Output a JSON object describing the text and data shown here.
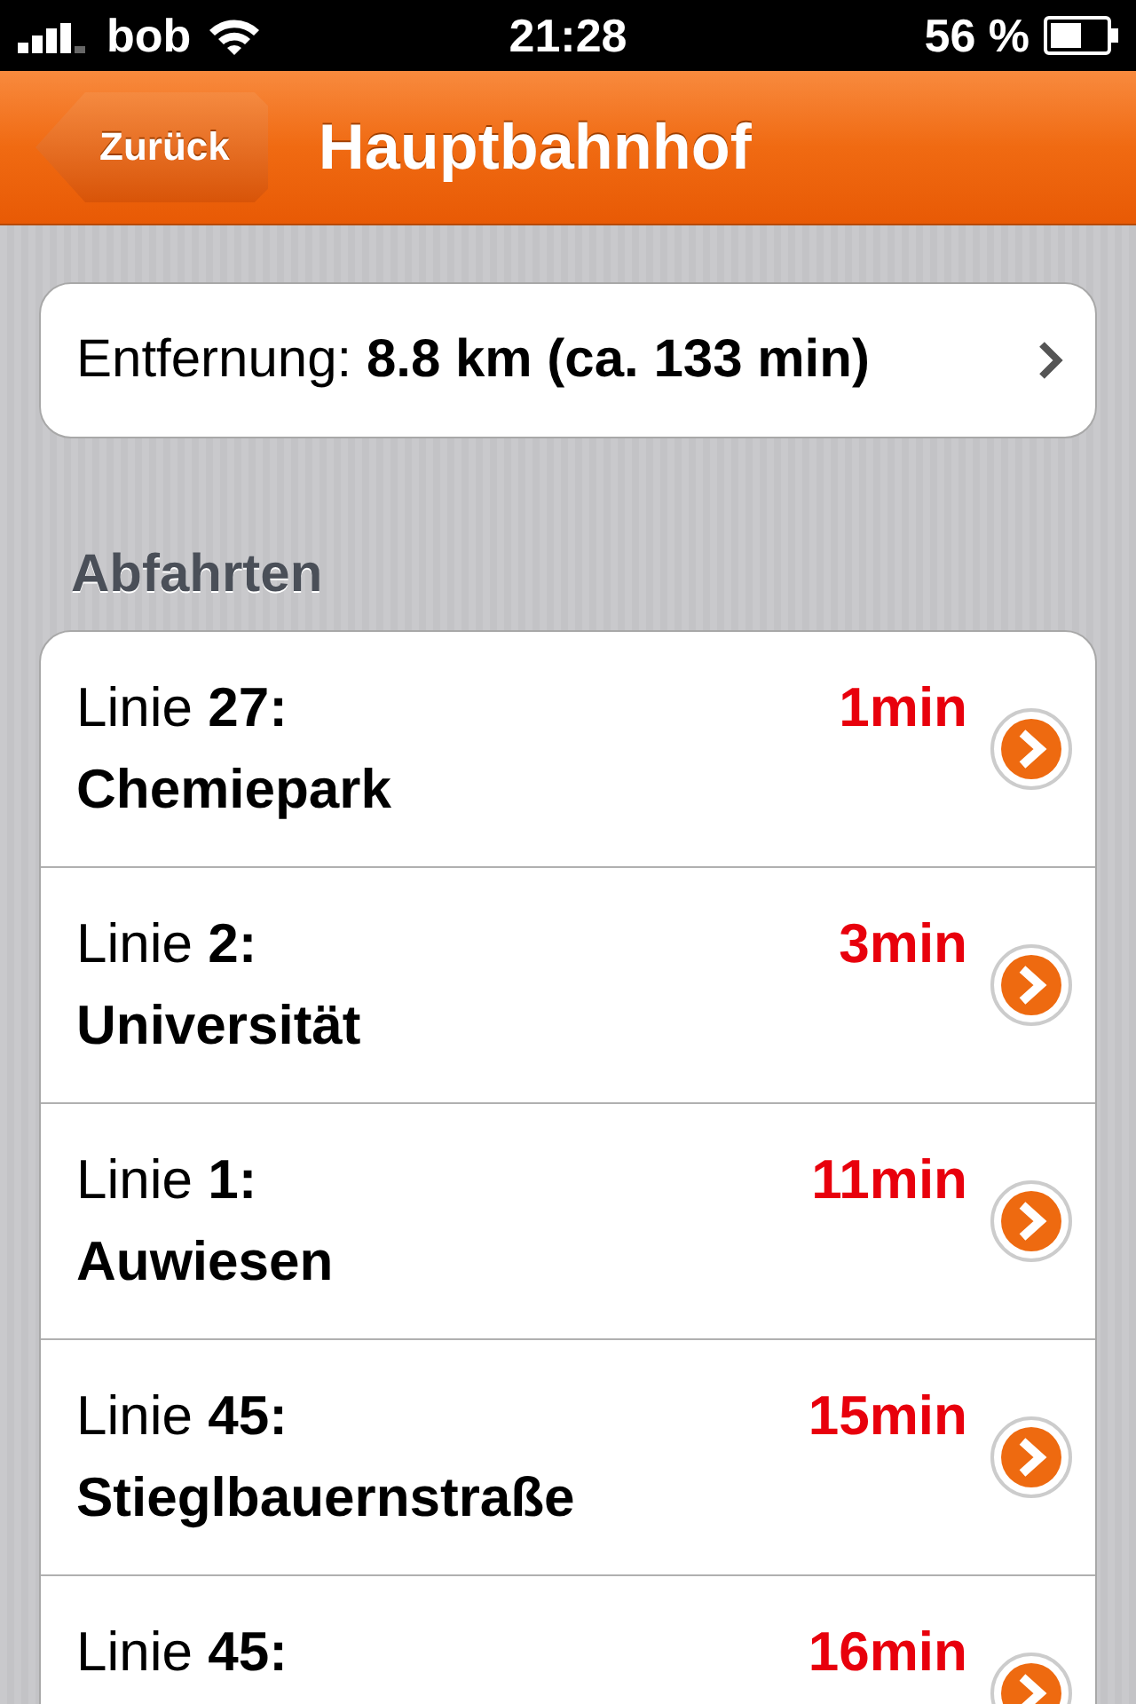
{
  "status_bar": {
    "carrier": "bob",
    "time": "21:28",
    "battery": "56 %"
  },
  "nav_bar": {
    "back": "Zurück",
    "title": "Hauptbahnhof"
  },
  "distance": {
    "text": "Entfernung: **8.8 km (ca. 133 min)**"
  },
  "section": {
    "title": "Abfahrten"
  },
  "departures": [
    {
      "line": "Linie **27:**",
      "destination": "Chemiepark",
      "time": "1min"
    },
    {
      "line": "Linie **2:**",
      "destination": "Universität",
      "time": "3min"
    },
    {
      "line": "Linie **1:**",
      "destination": "Auwiesen",
      "time": "11min"
    },
    {
      "line": "Linie **45:**",
      "destination": "Stieglbauernstraße",
      "time": "15min"
    },
    {
      "line": "Linie **45:**",
      "time": "16min"
    }
  ]
}
